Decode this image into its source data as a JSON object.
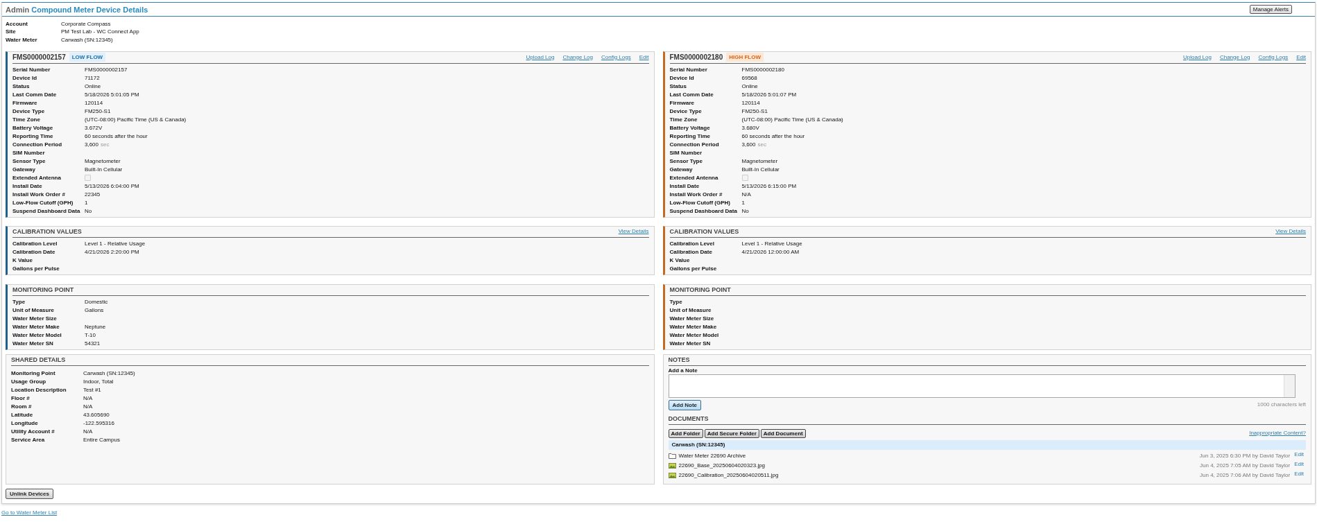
{
  "header": {
    "section": "Admin",
    "title": "Compound Meter Device Details",
    "button": "Manage Alerts"
  },
  "account_info": [
    {
      "label": "Account",
      "value": "Corporate Compass"
    },
    {
      "label": "Site",
      "value": "PM Test Lab - WC Connect App"
    },
    {
      "label": "Water Meter",
      "value": "Carwash (SN:12345)"
    }
  ],
  "devices": [
    {
      "kind": "low_flow",
      "name": "FMS0000002157",
      "badge": "LOW FLOW",
      "links": [
        "Upload Log",
        "Change Log",
        "Config Logs",
        "Edit"
      ],
      "fields": [
        {
          "kind": "text",
          "label": "Serial Number",
          "value": "FMS0000002157"
        },
        {
          "kind": "text",
          "label": "Device Id",
          "value": "71172"
        },
        {
          "kind": "text",
          "label": "Status",
          "value": "Online"
        },
        {
          "kind": "text",
          "label": "Last Comm Date",
          "value": "5/18/2026 5:01:05 PM"
        },
        {
          "kind": "text",
          "label": "Firmware",
          "value": "120114"
        },
        {
          "kind": "text",
          "label": "Device Type",
          "value": "FM250-S1"
        },
        {
          "kind": "text",
          "label": "Time Zone",
          "value": "(UTC-08:00) Pacific Time (US & Canada)"
        },
        {
          "kind": "text",
          "label": "Battery Voltage",
          "value": "3.672V"
        },
        {
          "kind": "text",
          "label": "Reporting Time",
          "value": "60 seconds after the hour"
        },
        {
          "kind": "text",
          "label": "Connection Period",
          "value": "3,600",
          "unit": "sec"
        },
        {
          "kind": "text",
          "label": "SIM Number"
        },
        {
          "kind": "text",
          "label": "Sensor Type",
          "value": "Magnetometer"
        },
        {
          "kind": "text",
          "label": "Gateway",
          "value": "Built-In Cellular"
        },
        {
          "kind": "checkbox",
          "label": "Extended Antenna",
          "checked": false
        },
        {
          "kind": "text",
          "label": "Install Date",
          "value": "5/13/2026 6:04:00 PM"
        },
        {
          "kind": "text",
          "label": "Install Work Order #",
          "value": "22345"
        },
        {
          "kind": "text",
          "label": "Low-Flow Cutoff (GPH)",
          "value": "1"
        },
        {
          "kind": "text",
          "label": "Suspend Dashboard Data",
          "value": "No"
        }
      ],
      "calibration": {
        "title": "CALIBRATION VALUES",
        "link": "View Details",
        "fields": [
          {
            "label": "Calibration Level",
            "value": "Level 1 - Relative Usage"
          },
          {
            "label": "Calibration Date",
            "value": "4/21/2026 2:20:00 PM"
          },
          {
            "label": "K Value"
          },
          {
            "label": "Gallons per Pulse"
          }
        ]
      },
      "monitoring": {
        "title": "MONITORING POINT",
        "fields": [
          {
            "label": "Type",
            "value": "Domestic"
          },
          {
            "label": "Unit of Measure",
            "value": "Gallons"
          },
          {
            "label": "Water Meter Size"
          },
          {
            "label": "Water Meter Make",
            "value": "Neptune"
          },
          {
            "label": "Water Meter Model",
            "value": "T-10"
          },
          {
            "label": "Water Meter SN",
            "value": "54321"
          }
        ]
      }
    },
    {
      "kind": "high_flow",
      "name": "FMS0000002180",
      "badge": "HIGH FLOW",
      "links": [
        "Upload Log",
        "Change Log",
        "Config Logs",
        "Edit"
      ],
      "fields": [
        {
          "kind": "text",
          "label": "Serial Number",
          "value": "FMS0000002180"
        },
        {
          "kind": "text",
          "label": "Device Id",
          "value": "69568"
        },
        {
          "kind": "text",
          "label": "Status",
          "value": "Online"
        },
        {
          "kind": "text",
          "label": "Last Comm Date",
          "value": "5/18/2026 5:01:07 PM"
        },
        {
          "kind": "text",
          "label": "Firmware",
          "value": "120114"
        },
        {
          "kind": "text",
          "label": "Device Type",
          "value": "FM250-S1"
        },
        {
          "kind": "text",
          "label": "Time Zone",
          "value": "(UTC-08:00) Pacific Time (US & Canada)"
        },
        {
          "kind": "text",
          "label": "Battery Voltage",
          "value": "3.680V"
        },
        {
          "kind": "text",
          "label": "Reporting Time",
          "value": "60 seconds after the hour"
        },
        {
          "kind": "text",
          "label": "Connection Period",
          "value": "3,600",
          "unit": "sec"
        },
        {
          "kind": "text",
          "label": "SIM Number"
        },
        {
          "kind": "text",
          "label": "Sensor Type",
          "value": "Magnetometer"
        },
        {
          "kind": "text",
          "label": "Gateway",
          "value": "Built-In Cellular"
        },
        {
          "kind": "checkbox",
          "label": "Extended Antenna",
          "checked": false
        },
        {
          "kind": "text",
          "label": "Install Date",
          "value": "5/13/2026 6:15:00 PM"
        },
        {
          "kind": "text",
          "label": "Install Work Order #",
          "value": "N/A"
        },
        {
          "kind": "text",
          "label": "Low-Flow Cutoff (GPH)",
          "value": "1"
        },
        {
          "kind": "text",
          "label": "Suspend Dashboard Data",
          "value": "No"
        }
      ],
      "calibration": {
        "title": "CALIBRATION VALUES",
        "link": "View Details",
        "fields": [
          {
            "label": "Calibration Level",
            "value": "Level 1 - Relative Usage"
          },
          {
            "label": "Calibration Date",
            "value": "4/21/2026 12:00:00 AM"
          },
          {
            "label": "K Value"
          },
          {
            "label": "Gallons per Pulse"
          }
        ]
      },
      "monitoring": {
        "title": "MONITORING POINT",
        "fields": [
          {
            "label": "Type"
          },
          {
            "label": "Unit of Measure"
          },
          {
            "label": "Water Meter Size"
          },
          {
            "label": "Water Meter Make"
          },
          {
            "label": "Water Meter Model"
          },
          {
            "label": "Water Meter SN"
          }
        ]
      }
    }
  ],
  "shared_details": {
    "title": "SHARED DETAILS",
    "fields": [
      {
        "label": "Monitoring Point",
        "value": "Carwash (SN:12345)"
      },
      {
        "label": "Usage Group",
        "value": "Indoor, Total"
      },
      {
        "label": "Location Description",
        "value": "Test #1"
      },
      {
        "label": "Floor #",
        "value": "N/A"
      },
      {
        "label": "Room #",
        "value": "N/A"
      },
      {
        "label": "Latitude",
        "value": "43.605690"
      },
      {
        "label": "Longitude",
        "value": "-122.595316"
      },
      {
        "label": "Utility Account #",
        "value": "N/A"
      },
      {
        "label": "Service Area",
        "value": "Entire Campus"
      }
    ]
  },
  "notes": {
    "title": "NOTES",
    "label": "Add a Note",
    "button": "Add Note",
    "counter": "1000 characters left"
  },
  "documents": {
    "title": "DOCUMENTS",
    "buttons": [
      "Add Folder",
      "Add Secure Folder",
      "Add Document"
    ],
    "link": "Inappropriate Content?",
    "group": "Carwash (SN:12345)",
    "files": [
      {
        "kind": "folder",
        "name": "Water Meter 22690 Archive",
        "meta": "Jun 3, 2025 6:30 PM by David Taylor",
        "action": "Edit"
      },
      {
        "kind": "image",
        "name": "22690_Base_20250604020323.jpg",
        "meta": "Jun 4, 2025 7:05 AM by David Taylor",
        "action": "Edit"
      },
      {
        "kind": "image",
        "name": "22690_Calibration_20250604020511.jpg",
        "meta": "Jun 4, 2025 7:06 AM by David Taylor",
        "action": "Edit"
      }
    ]
  },
  "footer": {
    "button": "Unlink Devices",
    "link": "Go to Water Meter List"
  }
}
